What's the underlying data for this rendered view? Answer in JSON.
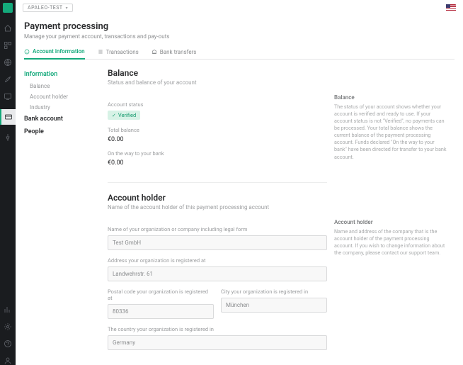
{
  "topbar": {
    "crumb": "APALEO-TEST"
  },
  "header": {
    "title": "Payment processing",
    "subtitle": "Manage your payment account, transactions and pay-outs"
  },
  "tabs": {
    "account_info": "Account information",
    "transactions": "Transactions",
    "bank_transfers": "Bank transfers"
  },
  "sidenav": {
    "information": "Information",
    "balance": "Balance",
    "account_holder": "Account holder",
    "industry": "Industry",
    "bank_account": "Bank account",
    "people": "People"
  },
  "balance": {
    "title": "Balance",
    "desc": "Status and balance of your account",
    "status_label": "Account status",
    "status_value": "Verified",
    "total_label": "Total balance",
    "total_value": "€0.00",
    "onway_label": "On the way to your bank",
    "onway_value": "€0.00",
    "help_title": "Balance",
    "help_body": "The status of your account shows whether your account is verified and ready to use. If your account status is not \"Verified\", no payments can be processed. Your total balance shows the current balance of the payment processing account. Funds declared \"On the way to your bank\" have been directed for transfer to your bank account."
  },
  "holder": {
    "title": "Account holder",
    "desc": "Name of the account holder of this payment processing account",
    "name_label": "Name of your organization or company including legal form",
    "name_value": "Test GmbH",
    "address_label": "Address your organization is registered at",
    "address_value": "Landwehrstr. 61",
    "postal_label": "Postal code your organization is registered at",
    "postal_value": "80336",
    "city_label": "City your organization is registered in",
    "city_value": "München",
    "country_label": "The country your organization is registered in",
    "country_value": "Germany",
    "help_title": "Account holder",
    "help_body": "Name and address of the company that is the account holder of the payment processing account. If you wish to change information about the company, please contact our support team."
  }
}
